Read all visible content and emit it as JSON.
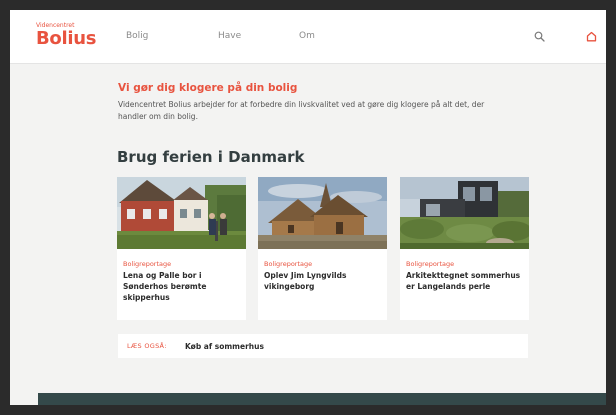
{
  "header": {
    "logo_small": "Videncentret",
    "logo_big": "Bolius",
    "brand_color": "#e8533f",
    "nav": [
      {
        "label": "Bolig"
      },
      {
        "label": "Have"
      },
      {
        "label": "Om"
      }
    ],
    "icons": [
      "search-icon",
      "home-icon"
    ]
  },
  "intro": {
    "title": "Vi gør dig klogere på din bolig",
    "text": "Videncentret Bolius arbejder for at forbedre din livskvalitet ved at gøre dig klogere på alt det, der handler om din bolig."
  },
  "section": {
    "title": "Brug ferien i Danmark"
  },
  "cards": [
    {
      "category": "Boligreportage",
      "title": "Lena og Palle bor i Sønderhos berømte skipperhus"
    },
    {
      "category": "Boligreportage",
      "title": "Oplev Jim Lyngvilds vikingeborg"
    },
    {
      "category": "Boligreportage",
      "title": "Arkitekttegnet sommerhus er Langelands perle"
    }
  ],
  "also": {
    "label": "LÆS OGSÅ:",
    "link": "Køb af sommerhus"
  },
  "colors": {
    "accent": "#e8533f",
    "footer": "#34494a",
    "background": "#f3f3f2"
  }
}
